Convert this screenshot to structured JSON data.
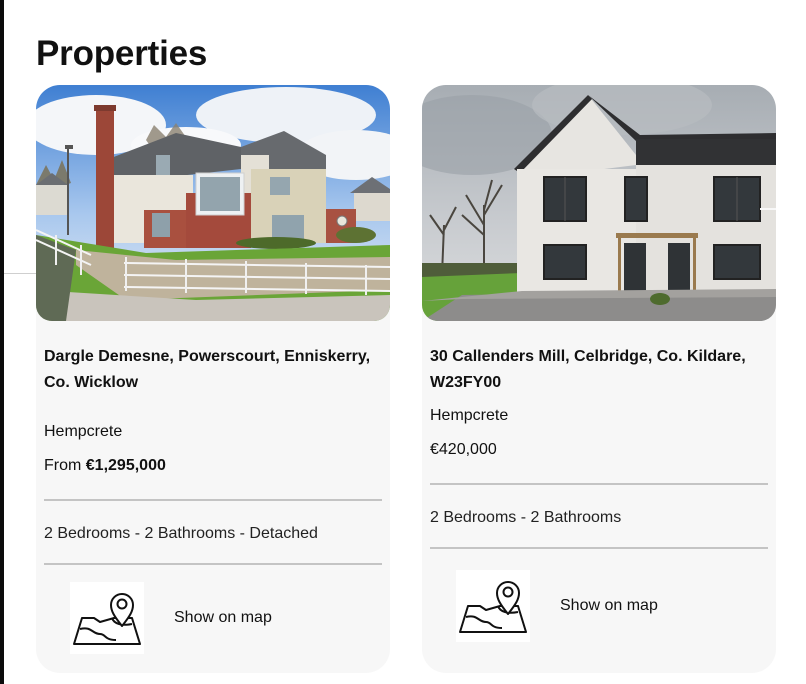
{
  "page": {
    "title": "Properties"
  },
  "properties": [
    {
      "address": "Dargle Demesne, Powerscourt, Enniskerry, Co. Wicklow",
      "material": "Hempcrete",
      "price_prefix": "From ",
      "price": "€1,295,000",
      "features": "2 Bedrooms - 2 Bathrooms - Detached",
      "map_label": "Show on map",
      "icon": "map-pin-icon"
    },
    {
      "address": "30 Callenders Mill, Celbridge, Co. Kildare, W23FY00",
      "material": "Hempcrete",
      "price_prefix": "",
      "price": "€420,000",
      "features": "2 Bedrooms - 2 Bathrooms",
      "map_label": "Show on map",
      "icon": "map-pin-icon"
    }
  ],
  "colors": {
    "card_background": "#f7f7f7",
    "divider": "#c4c4c4",
    "text": "#111111"
  }
}
